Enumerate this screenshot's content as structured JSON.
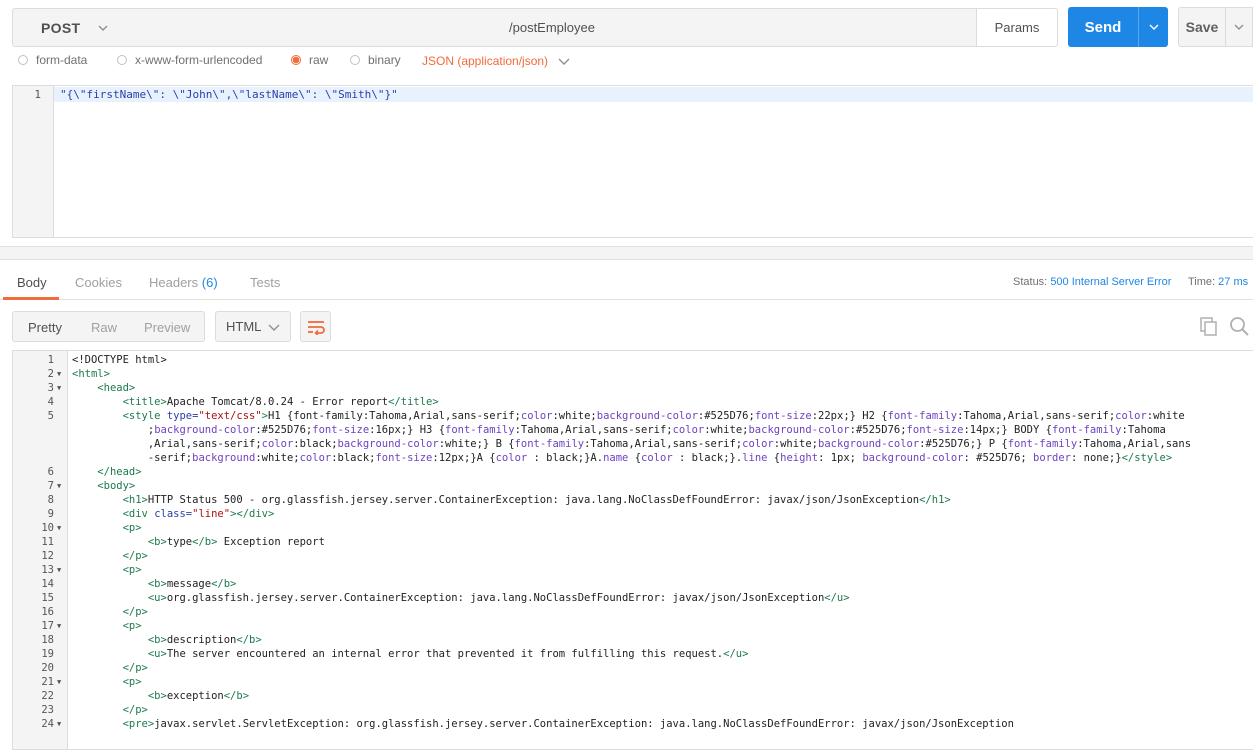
{
  "request": {
    "method": "POST",
    "url": "/postEmployee",
    "params_label": "Params",
    "send_label": "Send",
    "save_label": "Save"
  },
  "body_types": {
    "form_data": "form-data",
    "urlencoded": "x-www-form-urlencoded",
    "raw": "raw",
    "binary": "binary",
    "content_type": "JSON (application/json)"
  },
  "request_body": {
    "line_number": "1",
    "text": "\"{\\\"firstName\\\": \\\"John\\\",\\\"lastName\\\": \\\"Smith\\\"}\""
  },
  "response": {
    "tabs": {
      "body": "Body",
      "cookies": "Cookies",
      "headers": "Headers",
      "headers_count": "(6)",
      "tests": "Tests"
    },
    "status_label": "Status:",
    "status_value": "500 Internal Server Error",
    "time_label": "Time:",
    "time_value": "27 ms",
    "formats": {
      "pretty": "Pretty",
      "raw": "Raw",
      "preview": "Preview"
    },
    "language": "HTML"
  },
  "response_lines": [
    {
      "n": "1",
      "fold": "",
      "indent": "",
      "parts": [
        [
          "x",
          "<!DOCTYPE html>"
        ]
      ]
    },
    {
      "n": "2",
      "fold": "▼",
      "indent": "",
      "parts": [
        [
          "t",
          "<html>"
        ]
      ]
    },
    {
      "n": "3",
      "fold": "▼",
      "indent": "    ",
      "parts": [
        [
          "t",
          "<head>"
        ]
      ]
    },
    {
      "n": "4",
      "fold": "",
      "indent": "        ",
      "parts": [
        [
          "t",
          "<title>"
        ],
        [
          "x",
          "Apache Tomcat/8.0.24 - Error report"
        ],
        [
          "t",
          "</title>"
        ]
      ]
    },
    {
      "n": "5",
      "fold": "",
      "indent": "        ",
      "parts": [
        [
          "t",
          "<style "
        ],
        [
          "a",
          "type="
        ],
        [
          "s",
          "\"text/css\""
        ],
        [
          "t",
          ">"
        ],
        [
          "x",
          "H1 {font-family:Tahoma,Arial,sans-serif;"
        ],
        [
          "k",
          "color"
        ],
        [
          "x",
          ":white;"
        ],
        [
          "k",
          "background-color"
        ],
        [
          "x",
          ":#525D76;"
        ],
        [
          "k",
          "font-size"
        ],
        [
          "x",
          ":22px;} H2 {"
        ],
        [
          "k",
          "font-family"
        ],
        [
          "x",
          ":Tahoma,Arial,sans-serif;"
        ],
        [
          "k",
          "color"
        ],
        [
          "x",
          ":white"
        ]
      ]
    },
    {
      "n": "",
      "fold": "",
      "indent": "            ",
      "parts": [
        [
          "x",
          ";"
        ],
        [
          "k",
          "background-color"
        ],
        [
          "x",
          ":#525D76;"
        ],
        [
          "k",
          "font-size"
        ],
        [
          "x",
          ":16px;} H3 {"
        ],
        [
          "k",
          "font-family"
        ],
        [
          "x",
          ":Tahoma,Arial,sans-serif;"
        ],
        [
          "k",
          "color"
        ],
        [
          "x",
          ":white;"
        ],
        [
          "k",
          "background-color"
        ],
        [
          "x",
          ":#525D76;"
        ],
        [
          "k",
          "font-size"
        ],
        [
          "x",
          ":14px;} BODY {"
        ],
        [
          "k",
          "font-family"
        ],
        [
          "x",
          ":Tahoma"
        ]
      ]
    },
    {
      "n": "",
      "fold": "",
      "indent": "            ",
      "parts": [
        [
          "x",
          ",Arial,sans-serif;"
        ],
        [
          "k",
          "color"
        ],
        [
          "x",
          ":black;"
        ],
        [
          "k",
          "background-color"
        ],
        [
          "x",
          ":white;} B {"
        ],
        [
          "k",
          "font-family"
        ],
        [
          "x",
          ":Tahoma,Arial,sans-serif;"
        ],
        [
          "k",
          "color"
        ],
        [
          "x",
          ":white;"
        ],
        [
          "k",
          "background-color"
        ],
        [
          "x",
          ":#525D76;} P {"
        ],
        [
          "k",
          "font-family"
        ],
        [
          "x",
          ":Tahoma,Arial,sans"
        ]
      ]
    },
    {
      "n": "",
      "fold": "",
      "indent": "            ",
      "parts": [
        [
          "x",
          "-serif;"
        ],
        [
          "k",
          "background"
        ],
        [
          "x",
          ":white;"
        ],
        [
          "k",
          "color"
        ],
        [
          "x",
          ":black;"
        ],
        [
          "k",
          "font-size"
        ],
        [
          "x",
          ":12px;}A {"
        ],
        [
          "k",
          "color"
        ],
        [
          "x",
          " : black;}A."
        ],
        [
          "k",
          "name"
        ],
        [
          "x",
          " {"
        ],
        [
          "k",
          "color"
        ],
        [
          "x",
          " : black;}."
        ],
        [
          "k",
          "line"
        ],
        [
          "x",
          " {"
        ],
        [
          "k",
          "height"
        ],
        [
          "x",
          ": 1px; "
        ],
        [
          "k",
          "background-color"
        ],
        [
          "x",
          ": #525D76; "
        ],
        [
          "k",
          "border"
        ],
        [
          "x",
          ": none;}"
        ],
        [
          "t",
          "</style>"
        ]
      ]
    },
    {
      "n": "6",
      "fold": "",
      "indent": "    ",
      "parts": [
        [
          "t",
          "</head>"
        ]
      ]
    },
    {
      "n": "7",
      "fold": "▼",
      "indent": "    ",
      "parts": [
        [
          "t",
          "<body>"
        ]
      ]
    },
    {
      "n": "8",
      "fold": "",
      "indent": "        ",
      "parts": [
        [
          "t",
          "<h1>"
        ],
        [
          "x",
          "HTTP Status 500 - org.glassfish.jersey.server.ContainerException: java.lang.NoClassDefFoundError: javax/json/JsonException"
        ],
        [
          "t",
          "</h1>"
        ]
      ]
    },
    {
      "n": "9",
      "fold": "",
      "indent": "        ",
      "parts": [
        [
          "t",
          "<div "
        ],
        [
          "a",
          "class="
        ],
        [
          "s",
          "\"line\""
        ],
        [
          "t",
          "></div>"
        ]
      ]
    },
    {
      "n": "10",
      "fold": "▼",
      "indent": "        ",
      "parts": [
        [
          "t",
          "<p>"
        ]
      ]
    },
    {
      "n": "11",
      "fold": "",
      "indent": "            ",
      "parts": [
        [
          "t",
          "<b>"
        ],
        [
          "x",
          "type"
        ],
        [
          "t",
          "</b>"
        ],
        [
          "x",
          " Exception report"
        ]
      ]
    },
    {
      "n": "12",
      "fold": "",
      "indent": "        ",
      "parts": [
        [
          "t",
          "</p>"
        ]
      ]
    },
    {
      "n": "13",
      "fold": "▼",
      "indent": "        ",
      "parts": [
        [
          "t",
          "<p>"
        ]
      ]
    },
    {
      "n": "14",
      "fold": "",
      "indent": "            ",
      "parts": [
        [
          "t",
          "<b>"
        ],
        [
          "x",
          "message"
        ],
        [
          "t",
          "</b>"
        ]
      ]
    },
    {
      "n": "15",
      "fold": "",
      "indent": "            ",
      "parts": [
        [
          "t",
          "<u>"
        ],
        [
          "x",
          "org.glassfish.jersey.server.ContainerException: java.lang.NoClassDefFoundError: javax/json/JsonException"
        ],
        [
          "t",
          "</u>"
        ]
      ]
    },
    {
      "n": "16",
      "fold": "",
      "indent": "        ",
      "parts": [
        [
          "t",
          "</p>"
        ]
      ]
    },
    {
      "n": "17",
      "fold": "▼",
      "indent": "        ",
      "parts": [
        [
          "t",
          "<p>"
        ]
      ]
    },
    {
      "n": "18",
      "fold": "",
      "indent": "            ",
      "parts": [
        [
          "t",
          "<b>"
        ],
        [
          "x",
          "description"
        ],
        [
          "t",
          "</b>"
        ]
      ]
    },
    {
      "n": "19",
      "fold": "",
      "indent": "            ",
      "parts": [
        [
          "t",
          "<u>"
        ],
        [
          "x",
          "The server encountered an internal error that prevented it from fulfilling this request."
        ],
        [
          "t",
          "</u>"
        ]
      ]
    },
    {
      "n": "20",
      "fold": "",
      "indent": "        ",
      "parts": [
        [
          "t",
          "</p>"
        ]
      ]
    },
    {
      "n": "21",
      "fold": "▼",
      "indent": "        ",
      "parts": [
        [
          "t",
          "<p>"
        ]
      ]
    },
    {
      "n": "22",
      "fold": "",
      "indent": "            ",
      "parts": [
        [
          "t",
          "<b>"
        ],
        [
          "x",
          "exception"
        ],
        [
          "t",
          "</b>"
        ]
      ]
    },
    {
      "n": "23",
      "fold": "",
      "indent": "        ",
      "parts": [
        [
          "t",
          "</p>"
        ]
      ]
    },
    {
      "n": "24",
      "fold": "▼",
      "indent": "        ",
      "parts": [
        [
          "t",
          "<pre>"
        ],
        [
          "x",
          "javax.servlet.ServletException: org.glassfish.jersey.server.ContainerException: java.lang.NoClassDefFoundError: javax/json/JsonException"
        ]
      ]
    }
  ],
  "colors": {
    "accent_blue": "#1e87e6",
    "accent_orange": "#f26b3a",
    "tag_green": "#1d7a4d",
    "attr_blue": "#2a3fa8"
  }
}
